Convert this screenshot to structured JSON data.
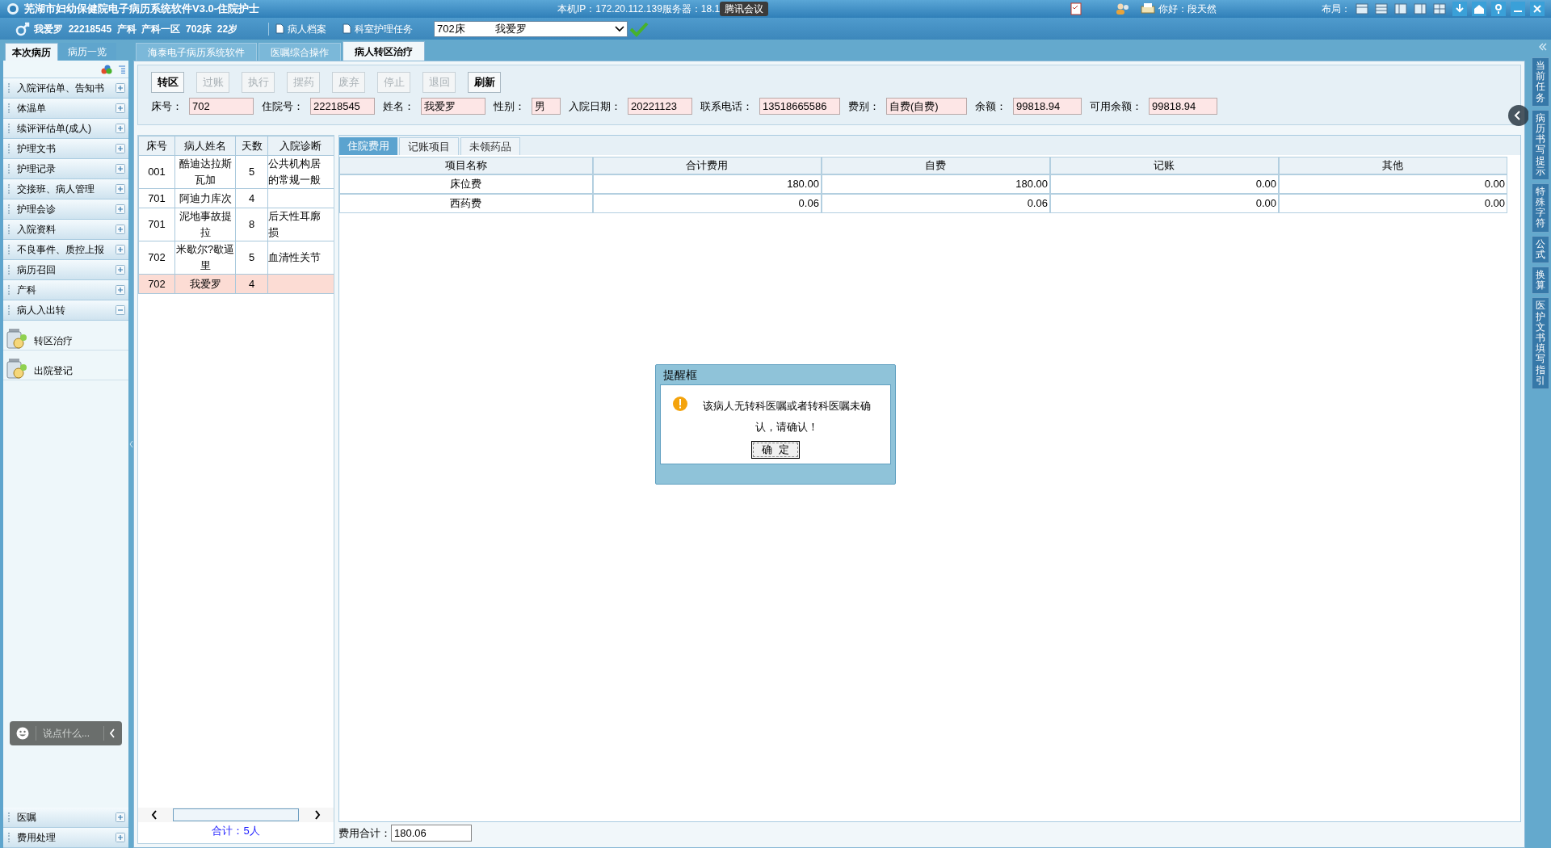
{
  "title_bar": {
    "title": "芜湖市妇幼保健院电子病历系统软件V3.0-住院护士",
    "ip_text": "本机IP：172.20.112.139服务器：18.1",
    "meeting_badge": "腾讯会议",
    "greeting": "你好：段天然",
    "layout_label": "布局："
  },
  "patient_bar": {
    "summary": "我爱罗  22218545  产科  产科一区  702床  22岁",
    "links": [
      "病人档案",
      "科室护理任务"
    ],
    "bed_select": {
      "bed": "702床",
      "name": "我爱罗"
    }
  },
  "side_tabs": [
    {
      "label": "本次病历",
      "selected": true
    },
    {
      "label": "病历一览",
      "selected": false
    }
  ],
  "doc_tabs": [
    {
      "label": "海泰电子病历系统软件",
      "selected": false
    },
    {
      "label": "医嘱综合操作",
      "selected": false
    },
    {
      "label": "病人转区治疗",
      "selected": true
    }
  ],
  "sidebar": {
    "sections": [
      {
        "label": "入院评估单、告知书",
        "expanded": false
      },
      {
        "label": "体温单",
        "expanded": false
      },
      {
        "label": "续评评估单(成人)",
        "expanded": false
      },
      {
        "label": "护理文书",
        "expanded": false
      },
      {
        "label": "护理记录",
        "expanded": false
      },
      {
        "label": "交接班、病人管理",
        "expanded": false
      },
      {
        "label": "护理会诊",
        "expanded": false
      },
      {
        "label": "入院资料",
        "expanded": false
      },
      {
        "label": "不良事件、质控上报",
        "expanded": false
      },
      {
        "label": "病历召回",
        "expanded": false
      },
      {
        "label": "产科",
        "expanded": false
      },
      {
        "label": "病人入出转",
        "expanded": true,
        "children": [
          {
            "label": "转区治疗"
          },
          {
            "label": "出院登记"
          }
        ]
      }
    ],
    "bottom_sections": [
      {
        "label": "医嘱",
        "expanded": false
      },
      {
        "label": "费用处理",
        "expanded": false
      }
    ],
    "chat_widget": {
      "placeholder": "说点什么..."
    }
  },
  "toolbar": [
    {
      "label": "转区",
      "disabled": false
    },
    {
      "label": "过账",
      "disabled": true
    },
    {
      "label": "执行",
      "disabled": true
    },
    {
      "label": "摆药",
      "disabled": true
    },
    {
      "label": "废弃",
      "disabled": true
    },
    {
      "label": "停止",
      "disabled": true
    },
    {
      "label": "退回",
      "disabled": true
    },
    {
      "label": "刷新",
      "disabled": false
    }
  ],
  "patient_info": [
    {
      "label": "床号：",
      "value": "702"
    },
    {
      "label": "住院号：",
      "value": "22218545"
    },
    {
      "label": "姓名：",
      "value": "我爱罗"
    },
    {
      "label": "性别：",
      "value": "男"
    },
    {
      "label": "入院日期：",
      "value": "20221123"
    },
    {
      "label": "联系电话：",
      "value": "13518665586"
    },
    {
      "label": "费别：",
      "value": "自费(自费)"
    },
    {
      "label": "余额：",
      "value": "99818.94"
    },
    {
      "label": "可用余额：",
      "value": "99818.94"
    }
  ],
  "patient_table": {
    "columns": [
      "床号",
      "病人姓名",
      "天数",
      "入院诊断"
    ],
    "rows": [
      {
        "cells": [
          "001",
          "酷迪达拉斯瓦加",
          "5",
          "公共机构居的常规一般"
        ],
        "selected": false
      },
      {
        "cells": [
          "701",
          "阿迪力库次",
          "4",
          ""
        ],
        "selected": false
      },
      {
        "cells": [
          "701",
          "泥地事故提拉",
          "8",
          "后天性耳廓损"
        ],
        "selected": false
      },
      {
        "cells": [
          "702",
          "米歇尔?歇逼里",
          "5",
          "血清性关节"
        ],
        "selected": false
      },
      {
        "cells": [
          "702",
          "我爱罗",
          "4",
          ""
        ],
        "selected": true
      }
    ],
    "total": "合计：5人"
  },
  "fee_tabs": [
    {
      "label": "住院费用",
      "selected": true
    },
    {
      "label": "记账项目",
      "selected": false
    },
    {
      "label": "未领药品",
      "selected": false
    }
  ],
  "fee_table": {
    "columns": [
      "项目名称",
      "合计费用",
      "自费",
      "记账",
      "其他"
    ],
    "rows": [
      [
        "床位费",
        "180.00",
        "180.00",
        "0.00",
        "0.00"
      ],
      [
        "西药费",
        "0.06",
        "0.06",
        "0.00",
        "0.00"
      ]
    ]
  },
  "fee_total": {
    "label": "费用合计：",
    "value": "180.06"
  },
  "right_strip": [
    "当前任务",
    "病历书写提示",
    "特殊字符",
    "公式",
    "换算",
    "医护文书填写指引"
  ],
  "dialog": {
    "title": "提醒框",
    "message": "该病人无转科医嘱或者转科医嘱未确认，请确认！",
    "button": "确  定"
  }
}
